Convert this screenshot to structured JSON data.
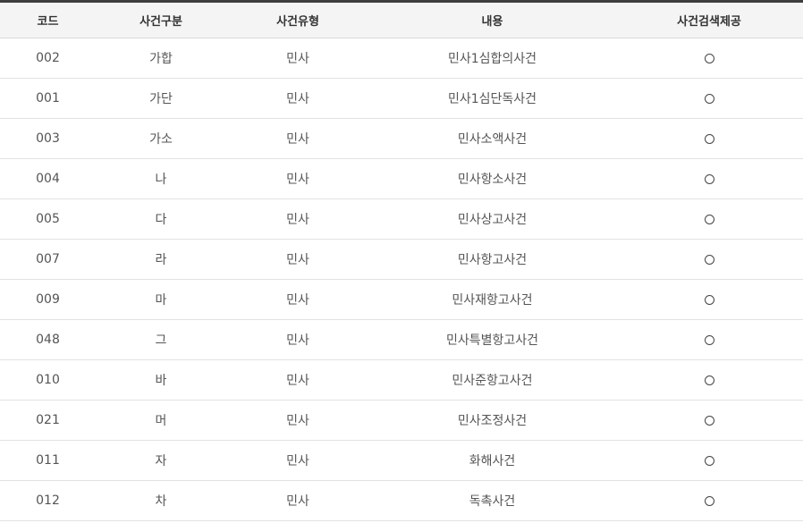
{
  "table": {
    "headers": [
      "코드",
      "사건구분",
      "사건유형",
      "내용",
      "사건검색제공"
    ],
    "rows": [
      {
        "code": "002",
        "division": "가합",
        "type": "민사",
        "content": "민사1심합의사건",
        "search_icon": "circle-icon"
      },
      {
        "code": "001",
        "division": "가단",
        "type": "민사",
        "content": "민사1심단독사건",
        "search_icon": "circle-icon"
      },
      {
        "code": "003",
        "division": "가소",
        "type": "민사",
        "content": "민사소액사건",
        "search_icon": "circle-icon"
      },
      {
        "code": "004",
        "division": "나",
        "type": "민사",
        "content": "민사항소사건",
        "search_icon": "circle-icon"
      },
      {
        "code": "005",
        "division": "다",
        "type": "민사",
        "content": "민사상고사건",
        "search_icon": "circle-icon"
      },
      {
        "code": "007",
        "division": "라",
        "type": "민사",
        "content": "민사항고사건",
        "search_icon": "circle-icon"
      },
      {
        "code": "009",
        "division": "마",
        "type": "민사",
        "content": "민사재항고사건",
        "search_icon": "circle-icon"
      },
      {
        "code": "048",
        "division": "그",
        "type": "민사",
        "content": "민사특별항고사건",
        "search_icon": "circle-icon"
      },
      {
        "code": "010",
        "division": "바",
        "type": "민사",
        "content": "민사준항고사건",
        "search_icon": "circle-icon"
      },
      {
        "code": "021",
        "division": "머",
        "type": "민사",
        "content": "민사조정사건",
        "search_icon": "circle-icon"
      },
      {
        "code": "011",
        "division": "자",
        "type": "민사",
        "content": "화해사건",
        "search_icon": "circle-icon"
      },
      {
        "code": "012",
        "division": "차",
        "type": "민사",
        "content": "독촉사건",
        "search_icon": "circle-icon"
      }
    ]
  },
  "colors": {
    "top_border": "#3d3d3d",
    "header_bg": "#f4f4f4",
    "row_border": "#e2e2e2"
  }
}
